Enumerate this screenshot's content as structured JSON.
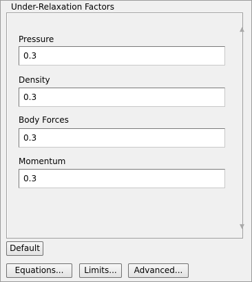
{
  "panel": {
    "group_title": "Under-Relaxation Factors",
    "fields": [
      {
        "label": "Pressure",
        "value": "0.3"
      },
      {
        "label": "Density",
        "value": "0.3"
      },
      {
        "label": "Body Forces",
        "value": "0.3"
      },
      {
        "label": "Momentum",
        "value": "0.3"
      }
    ]
  },
  "scrollbar": {
    "up_icon": "triangle-up",
    "down_icon": "triangle-down"
  },
  "buttons": {
    "default_label": "Default",
    "equations_label": "Equations...",
    "limits_label": "Limits...",
    "advanced_label": "Advanced..."
  }
}
